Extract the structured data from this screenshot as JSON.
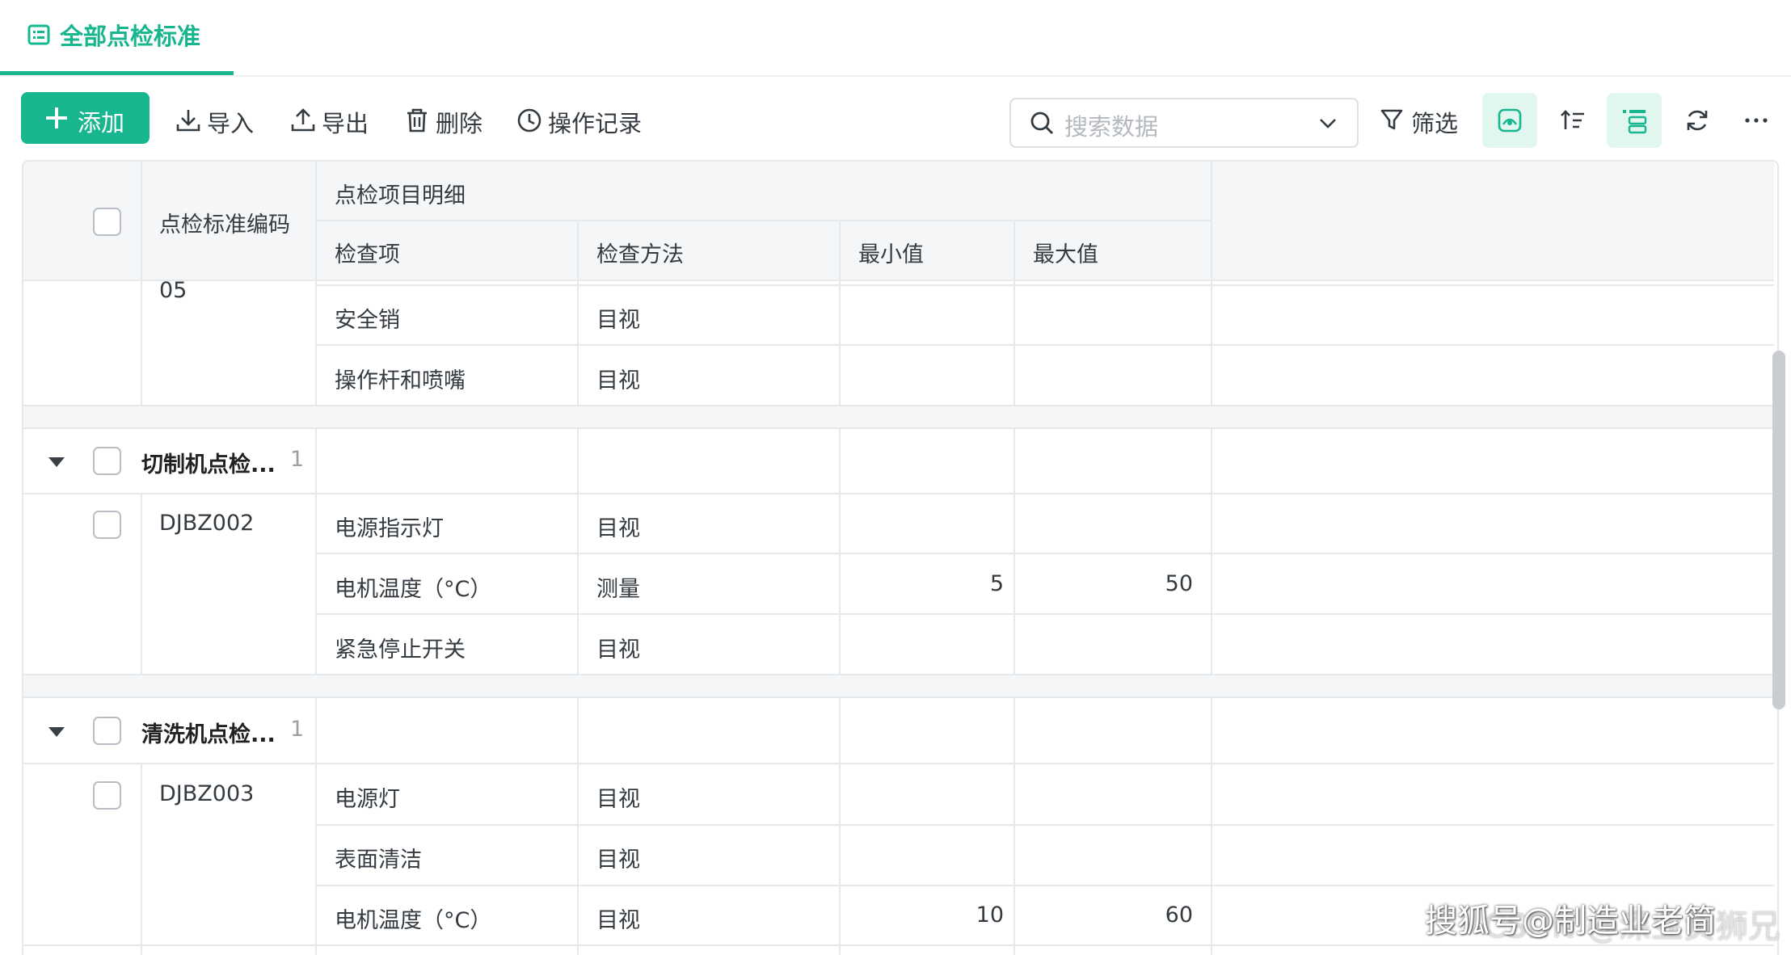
{
  "tab": {
    "label": "全部点检标准",
    "accent": "#17b68f"
  },
  "toolbar": {
    "add_label": "添加",
    "import_label": "导入",
    "export_label": "导出",
    "delete_label": "删除",
    "log_label": "操作记录",
    "search_placeholder": "搜索数据",
    "filter_label": "筛选"
  },
  "table": {
    "headers": {
      "code": "点检标准编码",
      "detail_group": "点检项目明细",
      "item": "检查项",
      "method": "检查方法",
      "min": "最小值",
      "max": "最大值"
    },
    "partial_group": {
      "code_fragment": "05",
      "rows": [
        {
          "item": "安全销",
          "method": "目视",
          "min": "",
          "max": ""
        },
        {
          "item": "操作杆和喷嘴",
          "method": "目视",
          "min": "",
          "max": ""
        }
      ]
    },
    "groups": [
      {
        "name": "切制机点检...",
        "count": "1",
        "code": "DJBZ002",
        "rows": [
          {
            "item": "电源指示灯",
            "method": "目视",
            "min": "",
            "max": ""
          },
          {
            "item": "电机温度（°C）",
            "method": "测量",
            "min": "5",
            "max": "50"
          },
          {
            "item": "紧急停止开关",
            "method": "目视",
            "min": "",
            "max": ""
          }
        ]
      },
      {
        "name": "清洗机点检...",
        "count": "1",
        "code": "DJBZ003",
        "rows": [
          {
            "item": "电源灯",
            "method": "目视",
            "min": "",
            "max": ""
          },
          {
            "item": "表面清洁",
            "method": "目视",
            "min": "",
            "max": ""
          },
          {
            "item": "电机温度（°C）",
            "method": "目视",
            "min": "10",
            "max": "60"
          }
        ]
      }
    ]
  },
  "watermark": {
    "text": "搜狐号@制造业老简",
    "text2": "CSDN @深业负狮兄"
  }
}
